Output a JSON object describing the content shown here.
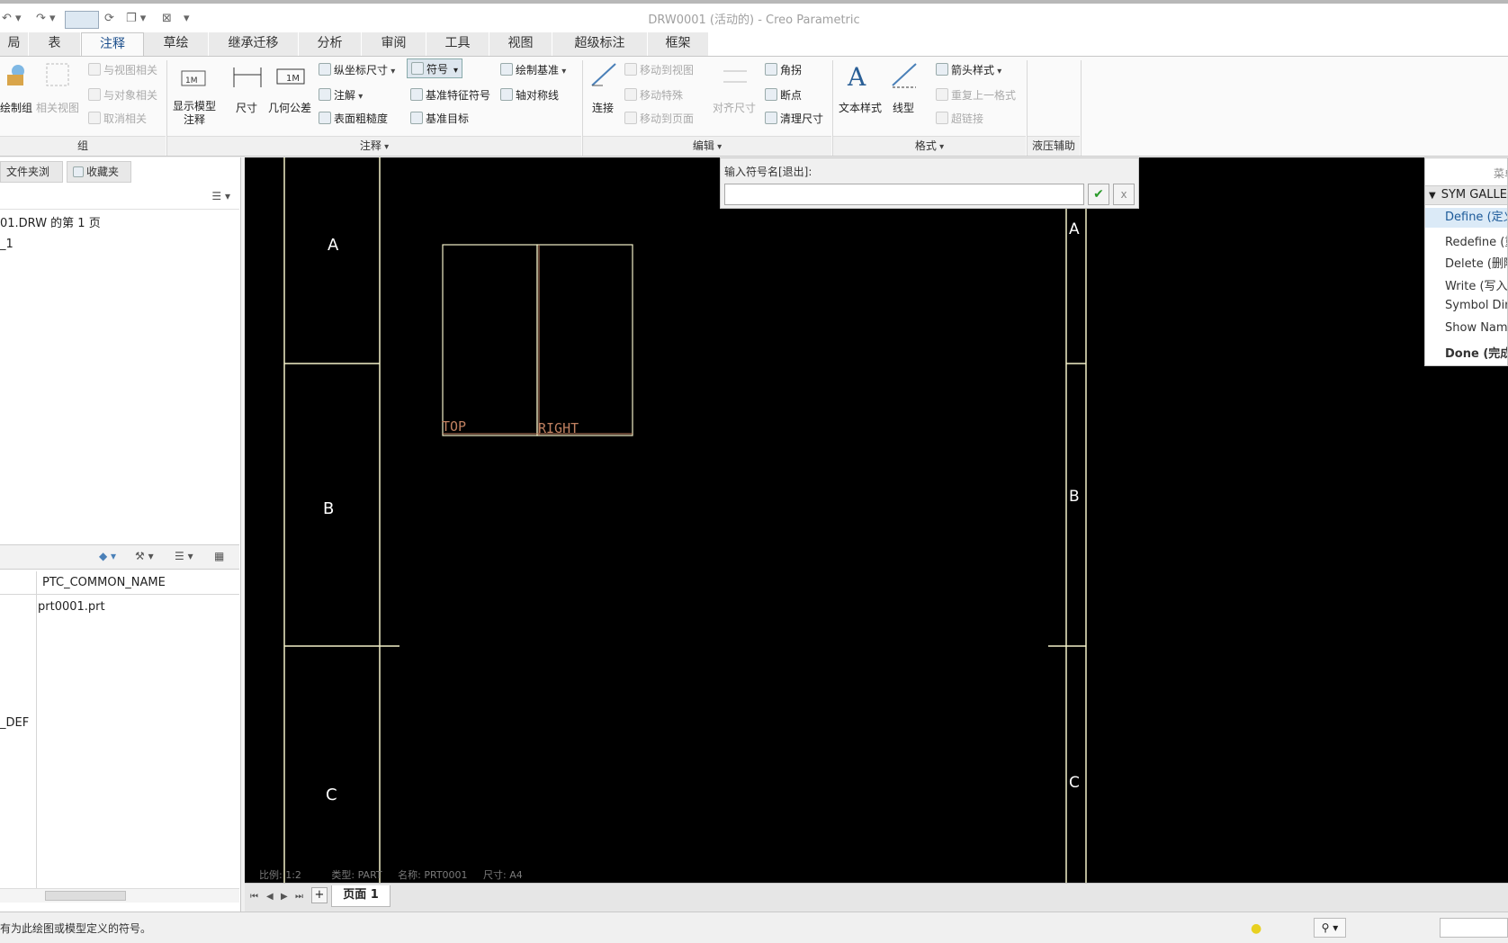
{
  "window": {
    "title": "DRW0001 (活动的) - Creo Parametric"
  },
  "tabs": [
    "局",
    "表",
    "注释",
    "草绘",
    "继承迁移",
    "分析",
    "审阅",
    "工具",
    "视图",
    "超级标注",
    "框架"
  ],
  "active_tab": "注释",
  "ribbon": {
    "group_zu": {
      "label": "组",
      "draw_group": "绘制组",
      "related_view": "相关视图",
      "with_view": "与视图相关",
      "with_object": "与对象相关",
      "cancel_related": "取消相关"
    },
    "group_annotation": {
      "label": "注释",
      "show_model_annotation": "显示模型注释",
      "show_model_annotation_l1": "显示模型",
      "show_model_annotation_l2": "注释",
      "dimension": "尺寸",
      "geometric_tolerance": "几何公差",
      "ordinate_dim": "纵坐标尺寸",
      "note": "注解",
      "surface_finish": "表面粗糙度",
      "symbol": "符号",
      "datum_feature_symbol": "基准特征符号",
      "datum_target": "基准目标",
      "draw_datum": "绘制基准",
      "axis_symmetric": "轴对称线"
    },
    "group_edit": {
      "label": "编辑",
      "connect": "连接",
      "move_to_view": "移动到视图",
      "move_special": "移动特殊",
      "move_to_page": "移动到页面",
      "align_dim": "对齐尺寸",
      "corner": "角拐",
      "breakpoint": "断点",
      "cleanup_dim": "清理尺寸"
    },
    "group_format": {
      "label": "格式",
      "text_style": "文本样式",
      "line_style": "线型",
      "arrow_style": "箭头样式",
      "repeat_format": "重复上一格式",
      "hyperlink": "超链接"
    },
    "group_hydraulic": {
      "label": "液压辅助"
    }
  },
  "left_panel": {
    "tabs": [
      "文件夹浏览器",
      "收藏夹"
    ],
    "tree": [
      "01.DRW 的第 1 页",
      "_1"
    ],
    "grid_header": "PTC_COMMON_NAME",
    "grid_values": [
      "prt0001.prt"
    ],
    "grid_left_values": [
      "_DEF"
    ]
  },
  "canvas": {
    "border_letters_left": [
      "A",
      "B",
      "C"
    ],
    "border_letters_right": [
      "A",
      "B",
      "C"
    ],
    "view_labels": [
      "TOP",
      "RIGHT"
    ],
    "info": {
      "scale": "比例: 1:2",
      "type": "类型: PART",
      "name": "名称: PRT0001",
      "size": "尺寸: A4"
    }
  },
  "symbol_dialog": {
    "label": "输入符号名[退出]:",
    "value": "",
    "ok": "✔",
    "cancel": "x"
  },
  "menu_manager": {
    "title": "菜单",
    "header": "SYM GALLERY",
    "items": [
      "Define (定义)",
      "Redefine (重定义)",
      "Delete (删除)",
      "Write (写入)",
      "Symbol Dir",
      "Show Names",
      "Done (完成)"
    ]
  },
  "sheet_bar": {
    "sheet_label": "页面 1",
    "add_label": "+"
  },
  "status_bar": {
    "message": "有为此绘图或模型定义的符号。"
  },
  "colors": {
    "active_tab": "#1c4f8c",
    "canvas_bg": "#000000",
    "border_line": "#f2f0c8",
    "view_label": "#c08060",
    "ok_check": "#2a9a2a",
    "menu_selected": "#dbeaf7"
  }
}
